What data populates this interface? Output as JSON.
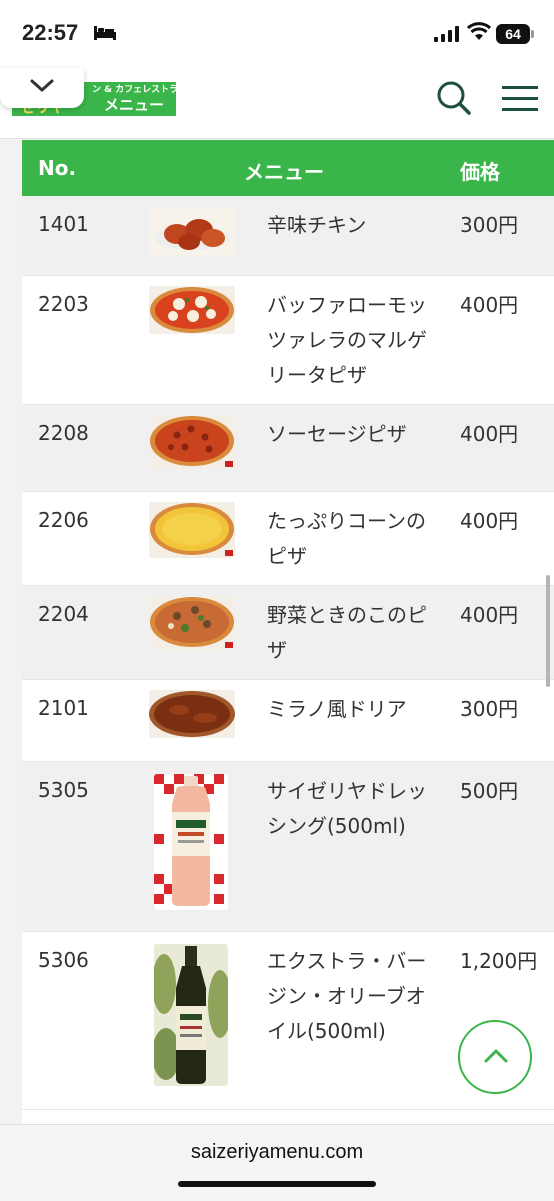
{
  "status_bar": {
    "time": "22:57",
    "battery": "64"
  },
  "header": {
    "logo_sub": "ン & カフェレストラン",
    "logo_main": "メニュー",
    "logo_left": "ゼリヤ"
  },
  "table": {
    "headers": {
      "no": "No.",
      "menu": "メニュー",
      "price": "価格"
    },
    "rows": [
      {
        "no": "1401",
        "name": "辛味チキン",
        "price": "300円",
        "image": "spicy-chicken-image"
      },
      {
        "no": "2203",
        "name": "バッファローモッツァレラのマルゲリータピザ",
        "price": "400円",
        "image": "margherita-pizza-image"
      },
      {
        "no": "2208",
        "name": "ソーセージピザ",
        "price": "400円",
        "image": "sausage-pizza-image"
      },
      {
        "no": "2206",
        "name": "たっぷりコーンのピザ",
        "price": "400円",
        "image": "corn-pizza-image"
      },
      {
        "no": "2204",
        "name": "野菜ときのこのピザ",
        "price": "400円",
        "image": "vegetable-mushroom-pizza-image"
      },
      {
        "no": "2101",
        "name": "ミラノ風ドリア",
        "price": "300円",
        "image": "milano-doria-image"
      },
      {
        "no": "5305",
        "name": "サイゼリヤドレッシング(500ml)",
        "price": "500円",
        "image": "dressing-bottle-image"
      },
      {
        "no": "5306",
        "name": "エクストラ・バージン・オリーブオイル(500ml)",
        "price": "1,200円",
        "image": "olive-oil-bottle-image"
      }
    ]
  },
  "url_bar": {
    "url": "saizeriyamenu.com"
  },
  "colors": {
    "brand_green": "#3ab54a",
    "row_alt": "#f0f0f0"
  }
}
